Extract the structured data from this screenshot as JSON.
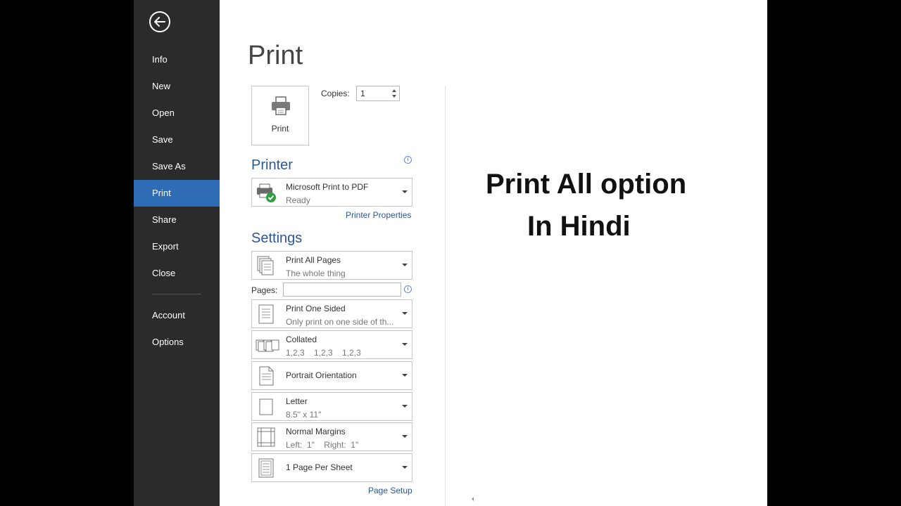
{
  "sidebar": {
    "items": [
      {
        "label": "Info"
      },
      {
        "label": "New"
      },
      {
        "label": "Open"
      },
      {
        "label": "Save"
      },
      {
        "label": "Save As"
      },
      {
        "label": "Print",
        "active": true
      },
      {
        "label": "Share"
      },
      {
        "label": "Export"
      },
      {
        "label": "Close"
      },
      {
        "label": "Account"
      },
      {
        "label": "Options"
      }
    ]
  },
  "page_title": "Print",
  "print_button_label": "Print",
  "copies": {
    "label": "Copies:",
    "value": "1"
  },
  "printer": {
    "heading": "Printer",
    "name": "Microsoft Print to PDF",
    "status": "Ready",
    "properties_link": "Printer Properties"
  },
  "settings": {
    "heading": "Settings",
    "pages_label": "Pages:",
    "pages_value": "",
    "options": [
      {
        "title": "Print All Pages",
        "subtitle": "The whole thing",
        "icon": "pages-icon"
      },
      {
        "title": "Print One Sided",
        "subtitle": "Only print on one side of th...",
        "icon": "one-sided-icon"
      },
      {
        "title": "Collated",
        "subtitle": "1,2,3    1,2,3    1,2,3",
        "icon": "collated-icon"
      },
      {
        "title": "Portrait Orientation",
        "subtitle": "",
        "icon": "portrait-icon"
      },
      {
        "title": "Letter",
        "subtitle": "8.5\" x 11\"",
        "icon": "letter-icon"
      },
      {
        "title": "Normal Margins",
        "subtitle": "Left:  1\"    Right:  1\"",
        "icon": "margins-icon"
      },
      {
        "title": "1 Page Per Sheet",
        "subtitle": "",
        "icon": "page-per-sheet-icon"
      }
    ],
    "page_setup_link": "Page Setup"
  },
  "overlay": {
    "line1": "Print All option",
    "line2": "In Hindi"
  },
  "colors": {
    "sidebar_bg": "#2b2b2b",
    "active_nav": "#2e6cb5",
    "heading_blue": "#2b5797"
  }
}
